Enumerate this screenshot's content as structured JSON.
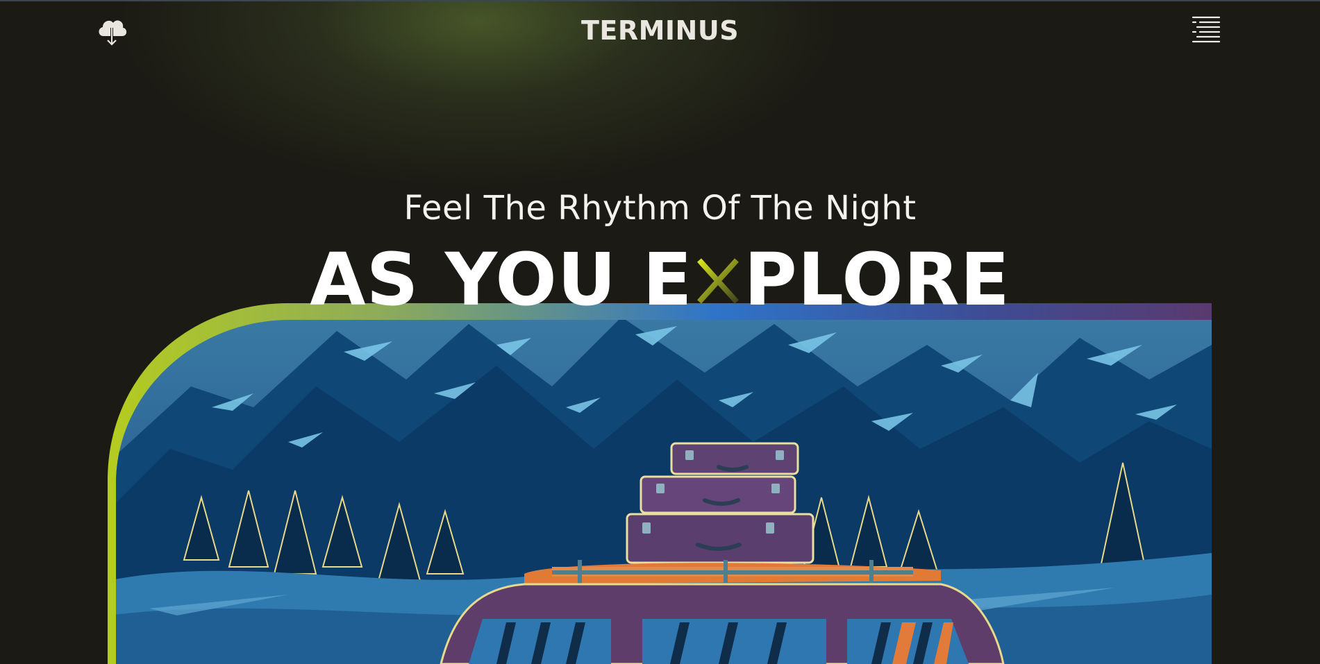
{
  "header": {
    "brand": "TERMINUS",
    "download_icon": "cloud-download-icon",
    "menu_icon": "menu-lines-icon"
  },
  "hero": {
    "tagline": "Feel The Rhythm Of The Night",
    "headline_part1": "AS YOU E",
    "headline_part2": "PLORE",
    "headline_x_icon": "x-mark-icon",
    "illustration": "mountain-night-van-illustration"
  },
  "colors": {
    "background": "#1b1a14",
    "accent_lime": "#c7d62a",
    "accent_blue": "#2f74c8",
    "accent_purple": "#5a3a6e",
    "text": "#ffffff"
  }
}
